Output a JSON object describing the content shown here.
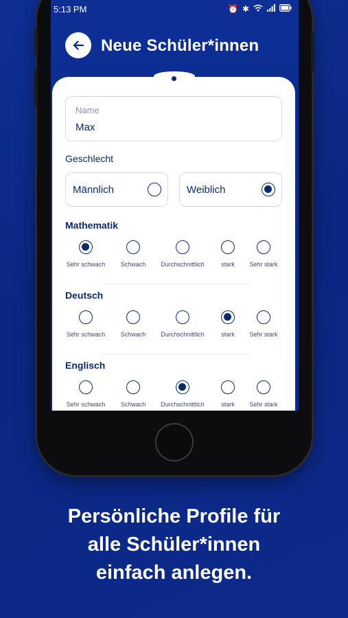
{
  "status_bar": {
    "time": "5:13 PM"
  },
  "header": {
    "title": "Neue Schüler*innen"
  },
  "form": {
    "name_label": "Name",
    "name_value": "Max",
    "gender_label": "Geschlecht",
    "gender_options": [
      {
        "label": "Männlich",
        "selected": false
      },
      {
        "label": "Weiblich",
        "selected": true
      }
    ],
    "scale_options": [
      "Sehr schwach",
      "Schwach",
      "Durchschnittlich",
      "stark",
      "Sehr stark"
    ],
    "subjects": [
      {
        "name": "Mathematik",
        "selected": 0
      },
      {
        "name": "Deutsch",
        "selected": 3
      },
      {
        "name": "Englisch",
        "selected": 2
      }
    ]
  },
  "caption": {
    "line1": "Persönliche Profile für",
    "line2": "alle Schüler*innen",
    "line3": "einfach anlegen."
  },
  "colors": {
    "background": "#0b2a8a",
    "accent": "#0a2a6e",
    "card": "#ffffff"
  }
}
